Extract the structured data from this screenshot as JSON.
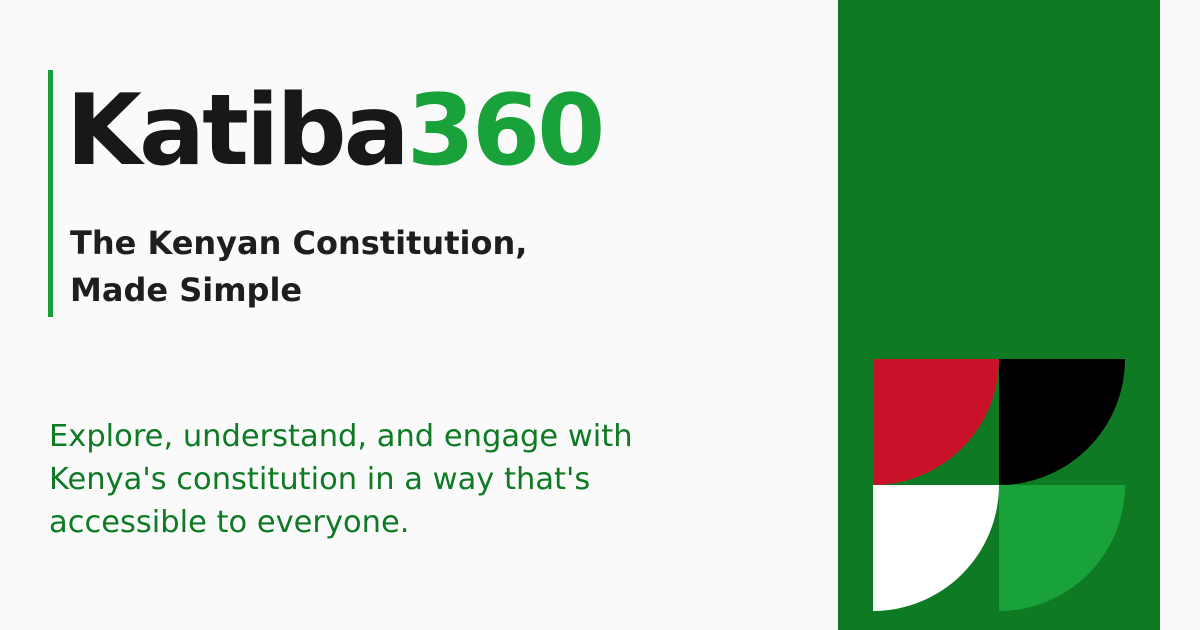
{
  "brand": {
    "name_main": "Katiba",
    "name_number": "360"
  },
  "tagline": {
    "line1": "The Kenyan Constitution,",
    "line2": "Made Simple"
  },
  "description": {
    "line1": "Explore, understand, and engage with",
    "line2": "Kenya's constitution in a way that's",
    "line3": "accessible to everyone."
  },
  "colors": {
    "background": "#fbfafb",
    "panel_green": "#0e7a24",
    "accent_green": "#1aa23a",
    "red": "#c9122a",
    "black": "#000000",
    "white": "#ffffff",
    "text_dark": "#181818"
  }
}
